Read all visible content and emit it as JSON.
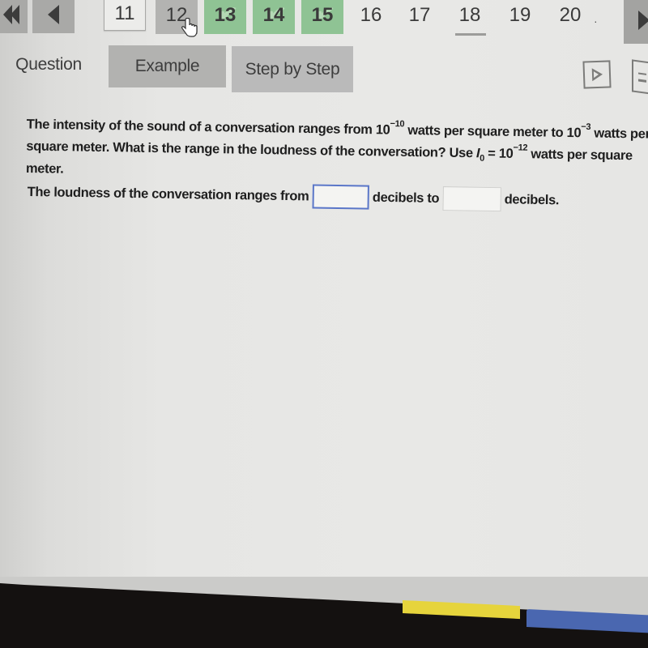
{
  "pager": {
    "first_icon": "double-chevron-left-icon",
    "prev_icon": "chevron-left-icon",
    "next_icon": "chevron-right-icon",
    "pages": [
      {
        "label": "11",
        "state": "outlined"
      },
      {
        "label": "12",
        "state": "visited"
      },
      {
        "label": "13",
        "state": "completed"
      },
      {
        "label": "14",
        "state": "completed"
      },
      {
        "label": "15",
        "state": "completed"
      },
      {
        "label": "16",
        "state": "default"
      },
      {
        "label": "17",
        "state": "default"
      },
      {
        "label": "18",
        "state": "current"
      },
      {
        "label": "19",
        "state": "default"
      },
      {
        "label": "20",
        "state": "default"
      }
    ],
    "trailing_dot": "·",
    "completed_color": "#8fc394"
  },
  "tabs": {
    "question": "Question",
    "example": "Example",
    "step_by_step": "Step by Step"
  },
  "tools": {
    "video_icon": "play-video-icon",
    "ebook_icon": "ebook-icon"
  },
  "question": {
    "part1": "The intensity of the sound of a conversation ranges from 10",
    "exp1": "−10",
    "part2": " watts per square meter to 10",
    "exp2": "−3",
    "part3": " watts per square meter. What is the range in the loudness of the conversation? Use ",
    "var": "I",
    "sub": "0",
    "part4": " = 10",
    "exp3": "−12",
    "part5": " watts per square meter."
  },
  "answer": {
    "prefix": "The loudness of the conversation ranges from ",
    "middle": " decibels to ",
    "suffix": " decibels.",
    "input1_value": "",
    "input2_value": ""
  },
  "footer": {
    "yellow_color": "#e6d43c",
    "blue_color": "#4a67b0"
  }
}
